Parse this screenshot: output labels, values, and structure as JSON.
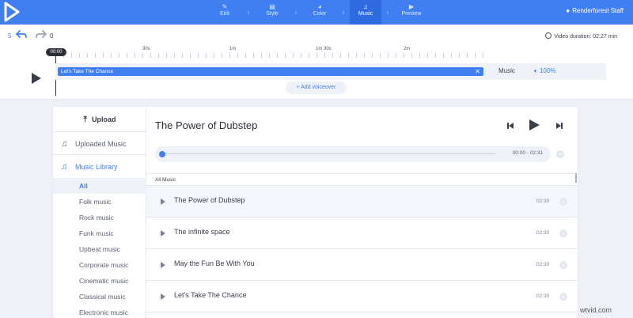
{
  "nav": {
    "steps": [
      {
        "icon": "✎",
        "label": "Edit"
      },
      {
        "icon": "▤",
        "label": "Style"
      },
      {
        "icon": "◕",
        "label": "Color"
      },
      {
        "icon": "♫",
        "label": "Music"
      },
      {
        "icon": "▶",
        "label": "Preview"
      }
    ],
    "active_step": "Music",
    "user": "Renderforest Staff"
  },
  "timeline": {
    "undo_count": "5",
    "redo_count": "0",
    "duration_text": "Video duration: 02:27 min",
    "playhead": "00:00",
    "ruler_labels": [
      "30s",
      "1m",
      "1m 30s",
      "2m"
    ],
    "clip_name": "Let's Take The Chance",
    "track_name": "Music",
    "volume": "100%",
    "add_voiceover": "Add voiceover"
  },
  "sidebar": {
    "upload_label": "Upload",
    "uploaded_music_label": "Uploaded Music",
    "music_library_label": "Music Library",
    "categories": [
      "All",
      "Folk music",
      "Rock music",
      "Funk music",
      "Upbeat music",
      "Corporate music",
      "Cinematic music",
      "Classical music",
      "Electronic music"
    ],
    "active_category": "All"
  },
  "player": {
    "title": "The Power of Dubstep",
    "progress_fraction": 0.0,
    "time": "00:00 - 02:31"
  },
  "list": {
    "header": "All Music",
    "songs": [
      {
        "name": "The Power of Dubstep",
        "duration": "02:30"
      },
      {
        "name": "The infinite space",
        "duration": "02:30"
      },
      {
        "name": "May the Fun Be With You",
        "duration": "02:30"
      },
      {
        "name": "Let's Take The Chance",
        "duration": "02:30"
      }
    ]
  },
  "watermark": "wtvid.com",
  "colors": {
    "accent": "#3f7ff2",
    "topbar": "#3f7ff2",
    "background": "#eef1f8"
  }
}
